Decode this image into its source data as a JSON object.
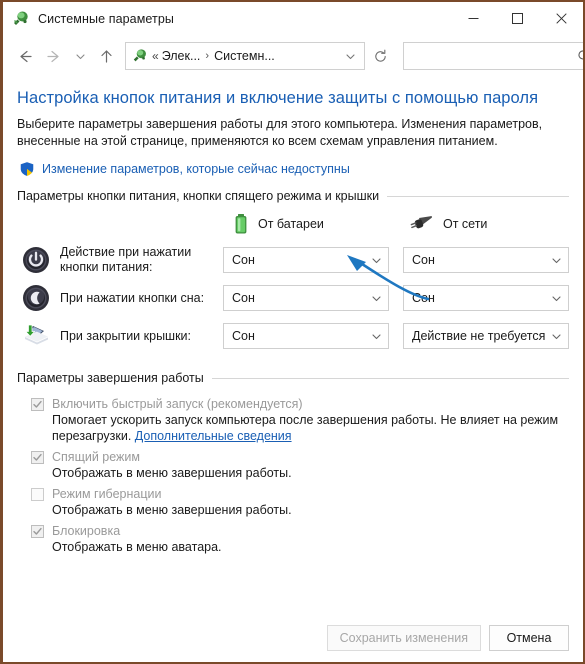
{
  "window": {
    "title": "Системные параметры",
    "icon": "power-plug-icon",
    "border_color": "#7a4a2a",
    "controls": {
      "minimize": "minimize-icon",
      "maximize": "maximize-icon",
      "close": "close-icon"
    }
  },
  "toolbar": {
    "back": "back-arrow-icon",
    "forward": "forward-arrow-icon",
    "recent": "chevron-down-icon",
    "up": "up-arrow-icon",
    "breadcrumb": {
      "icon": "power-plug-icon",
      "leading": "«",
      "items": [
        "Элек...",
        "Системн..."
      ],
      "separator": "›",
      "dropdown": "chevron-down-icon"
    },
    "refresh": "refresh-icon",
    "search": {
      "value": "",
      "placeholder": "",
      "icon": "search-icon"
    }
  },
  "page": {
    "title": "Настройка кнопок питания и включение защиты с помощью пароля",
    "description": "Выберите параметры завершения работы для этого компьютера. Изменения параметров, внесенные на этой странице, применяются ко всем схемам управления питанием.",
    "uac_link": "Изменение параметров, которые сейчас недоступны",
    "uac_icon": "shield-icon",
    "title_color": "#1a5fb4",
    "link_color": "#1a5fb4"
  },
  "power_section": {
    "group_label": "Параметры кнопки питания, кнопки спящего режима и крышки",
    "columns": [
      {
        "label": "От батареи",
        "icon": "battery-icon",
        "color": "#4caf50"
      },
      {
        "label": "От сети",
        "icon": "power-plug-icon",
        "color": "#3a3a3a"
      }
    ],
    "rows": [
      {
        "icon": "power-button-icon",
        "label": "Действие при нажатии кнопки питания:",
        "battery_value": "Сон",
        "ac_value": "Сон"
      },
      {
        "icon": "sleep-button-icon",
        "label": "При нажатии кнопки сна:",
        "battery_value": "Сон",
        "ac_value": "Сон"
      },
      {
        "icon": "laptop-lid-icon",
        "label": "При закрытии крышки:",
        "battery_value": "Сон",
        "ac_value": "Действие не требуется"
      }
    ],
    "dropdown_arrow": "chevron-down-icon"
  },
  "shutdown_section": {
    "group_label": "Параметры завершения работы",
    "items": [
      {
        "label": "Включить быстрый запуск (рекомендуется)",
        "checked": true,
        "disabled": true,
        "description": "Помогает ускорить запуск компьютера после завершения работы. Не влияет на режим перезагрузки. ",
        "link": "Дополнительные сведения"
      },
      {
        "label": "Спящий режим",
        "checked": true,
        "disabled": true,
        "description": "Отображать в меню завершения работы.",
        "link": ""
      },
      {
        "label": "Режим гибернации",
        "checked": false,
        "disabled": true,
        "description": "Отображать в меню завершения работы.",
        "link": ""
      },
      {
        "label": "Блокировка",
        "checked": true,
        "disabled": true,
        "description": "Отображать в меню аватара.",
        "link": ""
      }
    ]
  },
  "footer": {
    "save_label": "Сохранить изменения",
    "save_disabled": true,
    "cancel_label": "Отмена",
    "cancel_disabled": false
  },
  "annotation": {
    "type": "arrow",
    "color": "#1f78c1",
    "points_to": "uac-link"
  }
}
